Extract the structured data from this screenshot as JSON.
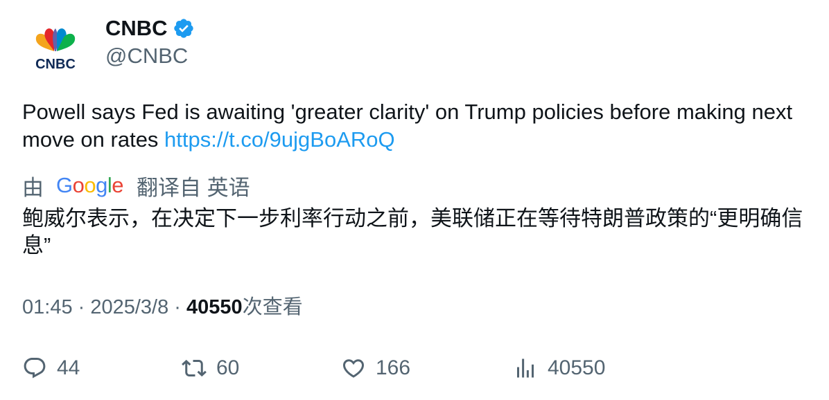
{
  "author": {
    "name": "CNBC",
    "handle": "@CNBC",
    "logo_text": "CNBC",
    "verified": true,
    "badge_color": "#1d9bf0"
  },
  "tweet": {
    "text": "Powell says Fed is awaiting 'greater clarity' on Trump policies before making next move on rates",
    "link": "https://t.co/9ujgBoARoQ"
  },
  "translation": {
    "by_label": "由",
    "provider": "Google",
    "from_label": "翻译自 英语",
    "text": "鲍威尔表示，在决定下一步利率行动之前，美联储正在等待特朗普政策的“更明确信息”"
  },
  "meta": {
    "time": "01:45",
    "separator": " · ",
    "date": "2025/3/8",
    "views": "40550",
    "views_label": "次查看"
  },
  "actions": {
    "replies": "44",
    "retweets": "60",
    "likes": "166",
    "views": "40550"
  },
  "colors": {
    "text": "#0f1419",
    "secondary": "#536471",
    "link": "#1d9bf0"
  },
  "icons": [
    "cnbc-peacock-logo",
    "verified-badge-icon",
    "google-logo",
    "reply-icon",
    "retweet-icon",
    "like-icon",
    "views-icon"
  ]
}
